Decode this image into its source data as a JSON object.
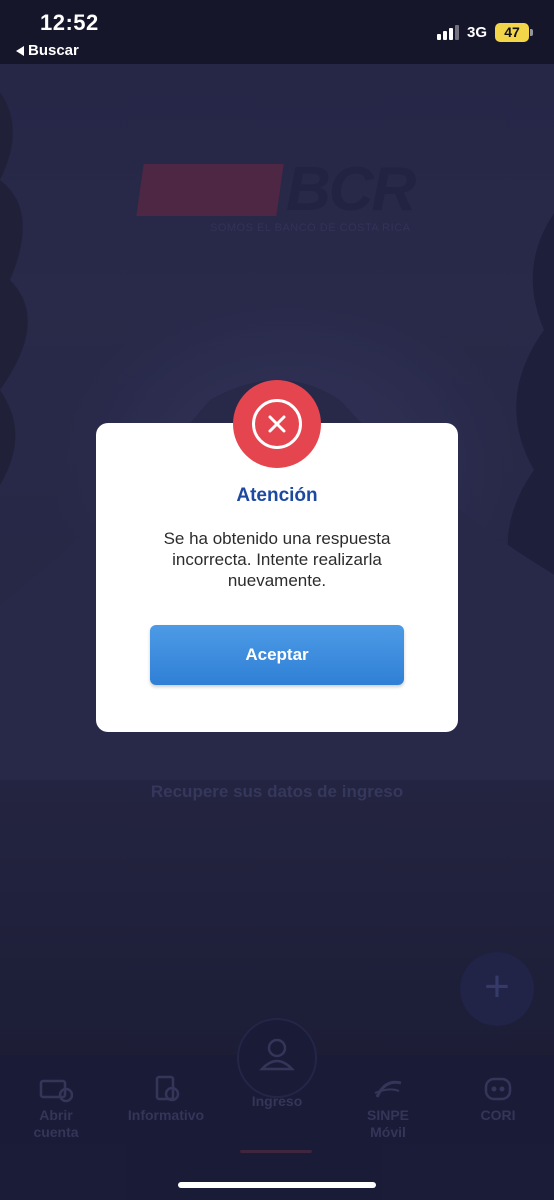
{
  "status_bar": {
    "time": "12:52",
    "back_label": "Buscar",
    "network": "3G",
    "battery": "47"
  },
  "logo": {
    "text": "BCR",
    "tagline": "SOMOS EL BANCO DE COSTA RICA"
  },
  "background": {
    "recover_link": "Recupere sus datos de ingreso"
  },
  "bottom_nav": {
    "items": [
      {
        "label": "Abrir cuenta",
        "icon": "open-account-icon"
      },
      {
        "label": "Informativo",
        "icon": "info-document-icon"
      },
      {
        "label": "Ingreso",
        "icon": "user-icon"
      },
      {
        "label": "SINPE Móvil",
        "icon": "sinpe-icon"
      },
      {
        "label": "CORI",
        "icon": "chatbot-icon"
      }
    ],
    "fab_icon": "plus-icon"
  },
  "dialog": {
    "icon": "error-close-icon",
    "title": "Atención",
    "message": "Se ha obtenido una respuesta incorrecta. Intente realizarla nuevamente.",
    "accept_label": "Aceptar"
  },
  "colors": {
    "error": "#e5454f",
    "title": "#1d4aa0",
    "button": "#3a8ade"
  }
}
